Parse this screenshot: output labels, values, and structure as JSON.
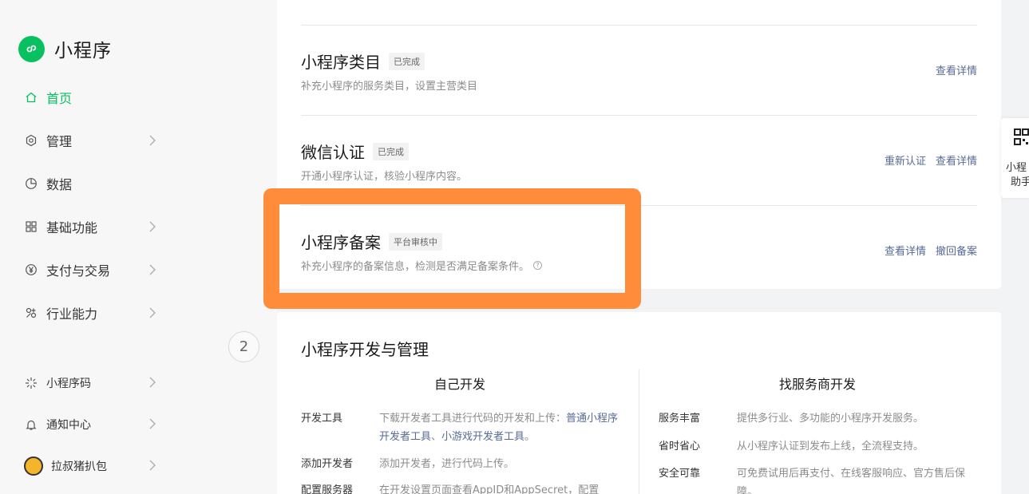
{
  "brand": {
    "title": "小程序"
  },
  "nav": {
    "home": "首页",
    "manage": "管理",
    "data": "数据",
    "basic": "基础功能",
    "pay": "支付与交易",
    "industry": "行业能力",
    "qrcode": "小程序码",
    "notify": "通知中心",
    "account": "拉叔猪扒包"
  },
  "page_badge": "2",
  "setup_rows": [
    {
      "title": "小程序类目",
      "status": "已完成",
      "desc": "补充小程序的服务类目，设置主营类目",
      "actions": [
        "查看详情"
      ]
    },
    {
      "title": "微信认证",
      "status": "已完成",
      "desc": "开通小程序认证，核验小程序内容。",
      "actions": [
        "重新认证",
        "查看详情"
      ]
    },
    {
      "title": "小程序备案",
      "status": "平台审核中",
      "desc": "补充小程序的备案信息，检测是否满足备案条件。",
      "actions": [
        "查看详情",
        "撤回备案"
      ]
    }
  ],
  "dev": {
    "title": "小程序开发与管理",
    "self_head": "自己开发",
    "vendor_head": "找服务商开发",
    "self_items": [
      {
        "k": "开发工具",
        "v": "下载开发者工具进行代码的开发和上传：",
        "link1": "普通小程序开发者工具",
        "sep": "、",
        "link2": "小游戏开发者工具",
        "end": "。"
      },
      {
        "k": "添加开发者",
        "v": "添加开发者，进行代码上传。"
      },
      {
        "k": "配置服务器",
        "v": "在开发设置页面查看AppID和AppSecret，配置"
      }
    ],
    "vendor_items": [
      {
        "k": "服务丰富",
        "v": "提供多行业、多功能的小程序开发服务。"
      },
      {
        "k": "省时省心",
        "v": "从小程序认证到发布上线，全流程支持。"
      },
      {
        "k": "安全可靠",
        "v": "可免费试用后再支付、在线客服响应、官方售后保障。"
      }
    ]
  },
  "float": {
    "line1": "小程",
    "line2": "助手"
  },
  "colors": {
    "accent": "#07c160",
    "link": "#576b95",
    "highlight": "#ff8c3a"
  }
}
